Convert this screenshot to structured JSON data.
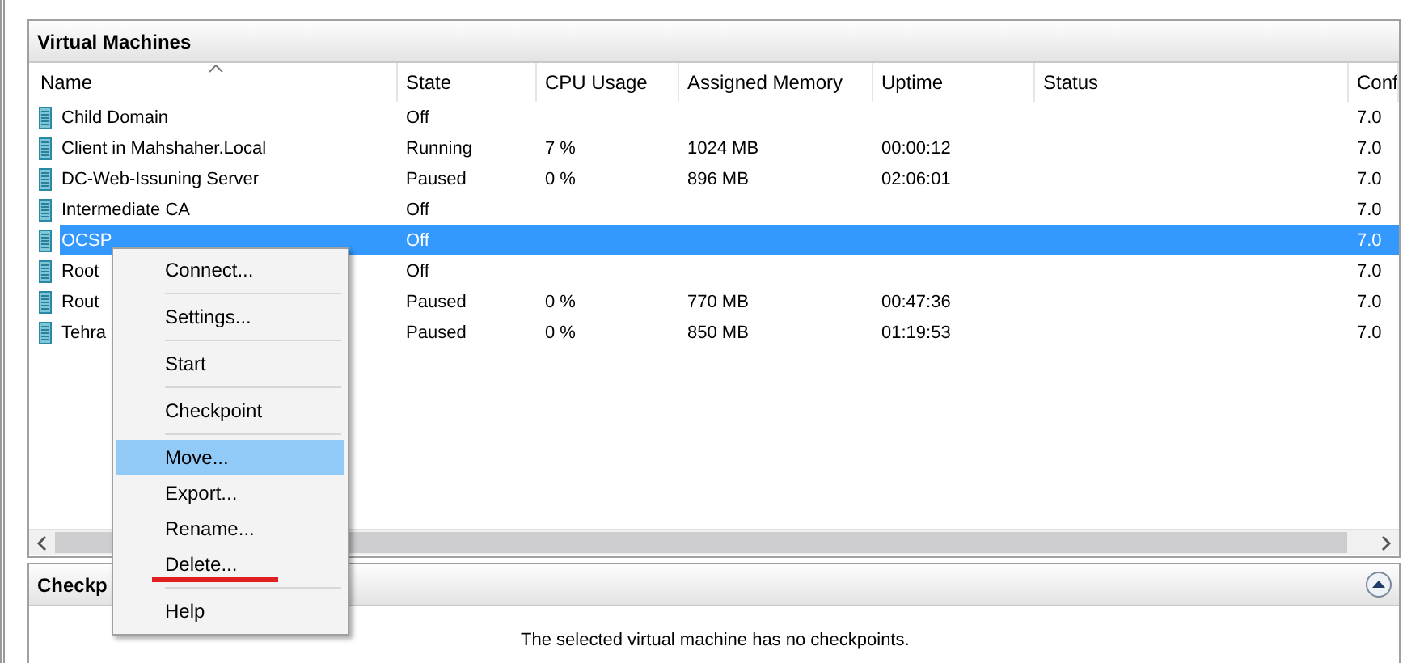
{
  "vm_panel": {
    "title": "Virtual Machines",
    "columns": [
      {
        "label": "Name",
        "sorted": true
      },
      {
        "label": "State",
        "sorted": false
      },
      {
        "label": "CPU Usage",
        "sorted": false
      },
      {
        "label": "Assigned Memory",
        "sorted": false
      },
      {
        "label": "Uptime",
        "sorted": false
      },
      {
        "label": "Status",
        "sorted": false
      },
      {
        "label": "Conf",
        "sorted": false
      }
    ],
    "rows": [
      {
        "cells": [
          "Child Domain",
          "Off",
          "",
          "",
          "",
          "",
          "7.0"
        ],
        "selected": false
      },
      {
        "cells": [
          "Client in Mahshaher.Local",
          "Running",
          "7 %",
          "1024 MB",
          "00:00:12",
          "",
          "7.0"
        ],
        "selected": false
      },
      {
        "cells": [
          "DC-Web-Issuning Server",
          "Paused",
          "0 %",
          "896 MB",
          "02:06:01",
          "",
          "7.0"
        ],
        "selected": false
      },
      {
        "cells": [
          "Intermediate CA",
          "Off",
          "",
          "",
          "",
          "",
          "7.0"
        ],
        "selected": false
      },
      {
        "cells": [
          "OCSP",
          "Off",
          "",
          "",
          "",
          "",
          "7.0"
        ],
        "selected": true
      },
      {
        "cells": [
          "Root",
          "Off",
          "",
          "",
          "",
          "",
          "7.0"
        ],
        "selected": false
      },
      {
        "cells": [
          "Rout",
          "Paused",
          "0 %",
          "770 MB",
          "00:47:36",
          "",
          "7.0"
        ],
        "selected": false
      },
      {
        "cells": [
          "Tehra",
          "Paused",
          "0 %",
          "850 MB",
          "01:19:53",
          "",
          "7.0"
        ],
        "selected": false
      }
    ]
  },
  "checkpoint_panel": {
    "title": "Checkp",
    "expanded": true,
    "message": "The selected virtual machine has no checkpoints."
  },
  "context_menu": {
    "items": [
      {
        "kind": "item",
        "label": "Connect...",
        "selected": false,
        "underlined": false
      },
      {
        "kind": "separator"
      },
      {
        "kind": "item",
        "label": "Settings...",
        "selected": false,
        "underlined": false
      },
      {
        "kind": "separator"
      },
      {
        "kind": "item",
        "label": "Start",
        "selected": false,
        "underlined": false
      },
      {
        "kind": "separator"
      },
      {
        "kind": "item",
        "label": "Checkpoint",
        "selected": false,
        "underlined": false
      },
      {
        "kind": "separator"
      },
      {
        "kind": "item",
        "label": "Move...",
        "selected": true,
        "underlined": false
      },
      {
        "kind": "item",
        "label": "Export...",
        "selected": false,
        "underlined": false
      },
      {
        "kind": "item",
        "label": "Rename...",
        "selected": false,
        "underlined": false
      },
      {
        "kind": "item",
        "label": "Delete...",
        "selected": false,
        "underlined": true
      },
      {
        "kind": "separator"
      },
      {
        "kind": "item",
        "label": "Help",
        "selected": false,
        "underlined": false
      }
    ]
  }
}
